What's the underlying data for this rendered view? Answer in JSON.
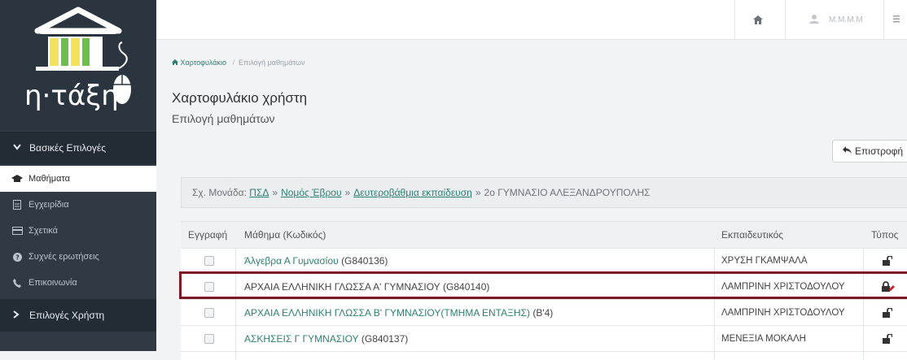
{
  "logo": {
    "text": "η·τάξη"
  },
  "sidebar": {
    "section_basic": "Βασικές Επιλογές",
    "items": [
      {
        "label": "Μαθήματα",
        "icon": "graduation-cap-icon",
        "active": true
      },
      {
        "label": "Εγχειρίδια",
        "icon": "file-icon",
        "active": false
      },
      {
        "label": "Σχετικά",
        "icon": "credit-card-icon",
        "active": false
      },
      {
        "label": "Συχνές ερωτήσεις",
        "icon": "question-circle-icon",
        "active": false
      },
      {
        "label": "Επικοινωνία",
        "icon": "phone-icon",
        "active": false
      }
    ],
    "section_user": "Επιλογές Χρήστη"
  },
  "topbar": {
    "user_name": "Μ.Μ.Μ.Μ"
  },
  "breadcrumb": {
    "home": "Χαρτοφυλάκιο",
    "current": "Επιλογή μαθημάτων"
  },
  "page": {
    "title": "Χαρτοφυλάκιο χρήστη",
    "subtitle": "Επιλογή μαθημάτων"
  },
  "back_button": "Επιστροφή",
  "info": {
    "prefix": "Σχ. Μονάδα:",
    "link1": "ΠΣΔ",
    "link2": "Νομός Έβρου",
    "link3": "Δευτεροβάθμια εκπαίδευση",
    "school": "2ο ΓΥΜΝΑΣΙΟ ΑΛΕΞΑΝΔΡΟΥΠΟΛΗΣ",
    "sep": "»"
  },
  "table": {
    "headers": {
      "enroll": "Εγγραφή",
      "course": "Μάθημα (Κωδικός)",
      "teacher": "Εκπαιδευτικός",
      "type": "Τύπος"
    },
    "rows": [
      {
        "course": "Άλγεβρα Α Γυμνασίου",
        "code": "(G840136)",
        "teacher": "ΧΡΥΣΗ ΓΚΑΜΨΑΛΑ",
        "type_icon": "unlock-icon"
      },
      {
        "course": "ΑΡΧΑΙΑ ΕΛΛΗΝΙΚΗ ΓΛΩΣΣΑ Α' ΓΥΜΝΑΣΙΟΥ",
        "code": "(G840140)",
        "teacher": "ΛΑΜΠΡΙΝΗ ΧΡΙΣΤΟΔΟΥΛΟΥ",
        "type_icon": "lock-pencil-icon"
      },
      {
        "course": "ΑΡΧΑΙΑ ΕΛΛΗΝΙΚΗ ΓΛΩΣΣΑ Β' ΓΥΜΝΑΣΙΟΥ(ΤΜΗΜΑ ΕΝΤΑΞΗΣ)",
        "code": "(Β'4)",
        "teacher": "ΛΑΜΠΡΙΝΗ ΧΡΙΣΤΟΔΟΥΛΟΥ",
        "type_icon": "unlock-icon"
      },
      {
        "course": "ΑΣΚΗΣΕΙΣ Γ ΓΥΜΝΑΣΙΟΥ",
        "code": "(G840137)",
        "teacher": "ΜΕΝΕΞΙΑ ΜΟΚΑΛΗ",
        "type_icon": "unlock-icon"
      }
    ]
  },
  "colors": {
    "sidebar": "#303a44",
    "accent_link": "#2e7f73",
    "highlight": "#7a1a24"
  }
}
